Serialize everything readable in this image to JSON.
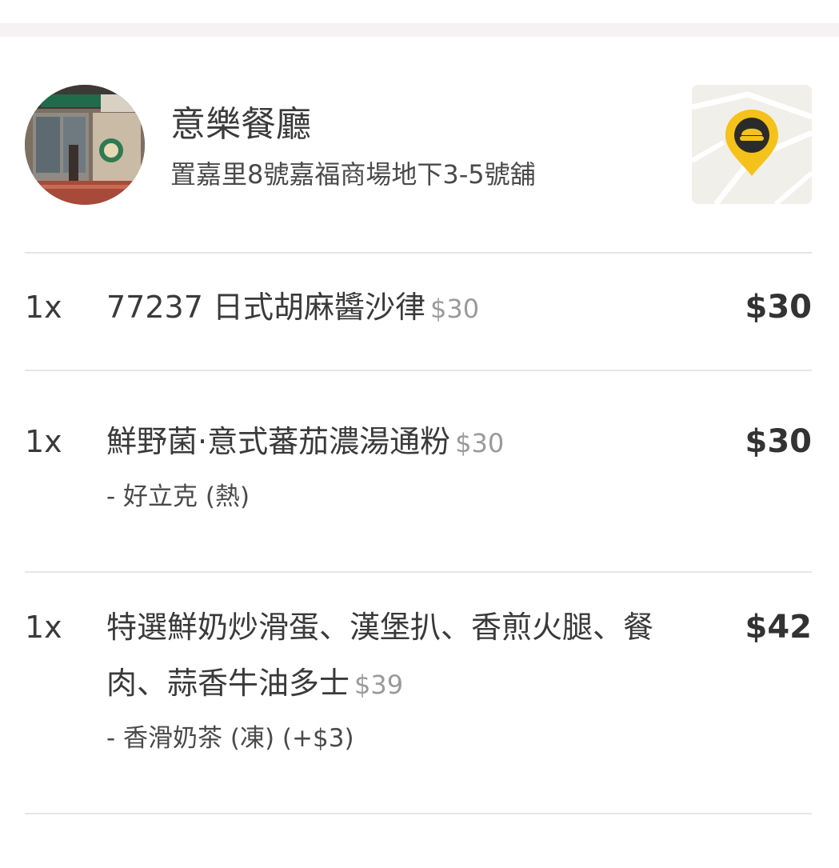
{
  "restaurant": {
    "name": "意樂餐廳",
    "address": "置嘉里8號嘉福商場地下3-5號舖"
  },
  "order_items": [
    {
      "qty": "1x",
      "name": "77237 日式胡麻醬沙律",
      "unit_price": "$30",
      "option": "",
      "total": "$30"
    },
    {
      "qty": "1x",
      "name": "鮮野菌·意式蕃茄濃湯通粉",
      "unit_price": "$30",
      "option": "- 好立克 (熱)",
      "total": "$30"
    },
    {
      "qty": "1x",
      "name": "特選鮮奶炒滑蛋、漢堡扒、香煎火腿、餐肉、蒜香牛油多士",
      "unit_price": "$39",
      "option": "- 香滑奶茶 (凍) (+$3)",
      "total": "$42"
    }
  ],
  "colors": {
    "pin": "#f4c21a",
    "divider": "#e6e6e6",
    "muted_price": "#9a9a9a"
  }
}
